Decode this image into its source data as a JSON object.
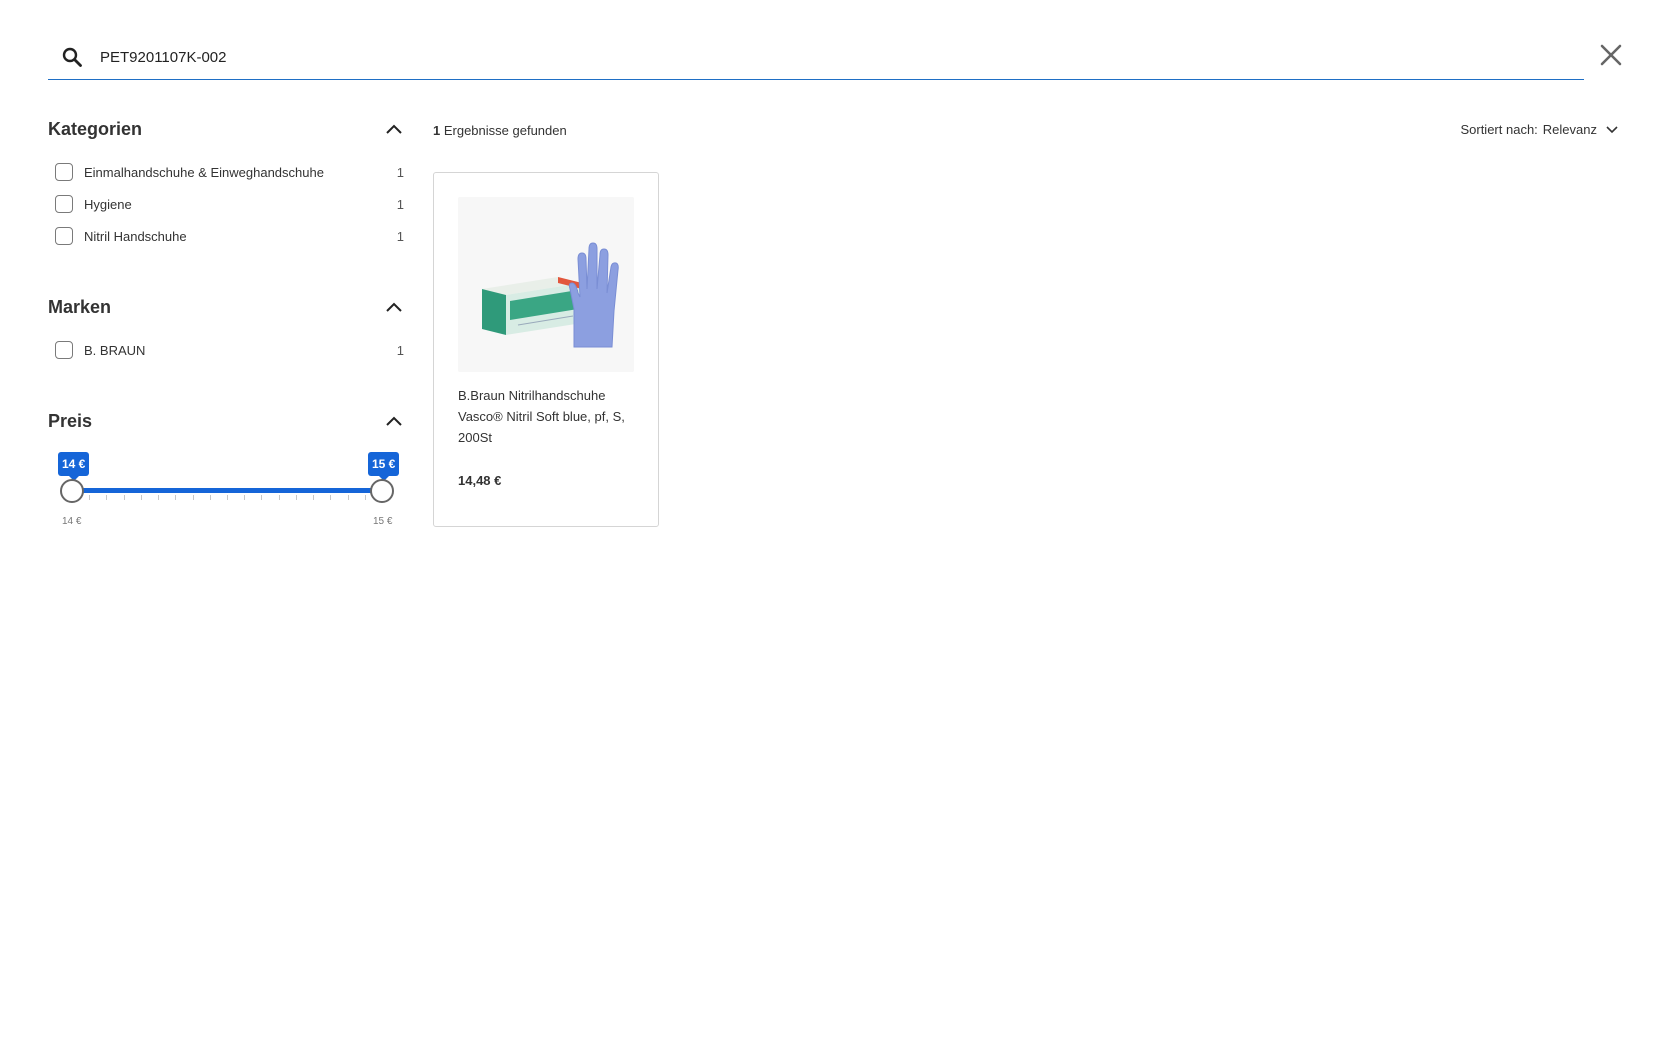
{
  "search": {
    "value": "PET9201107K-002",
    "accent_color": "#1f6fc5"
  },
  "icons": {
    "search": "search-icon",
    "close": "close-icon",
    "collapse": "chevron-up-icon",
    "sort": "chevron-down-icon"
  },
  "facets": {
    "kategorien": {
      "title": "Kategorien",
      "items": [
        {
          "label": "Einmalhandschuhe & Einweghandschuhe",
          "count": "1"
        },
        {
          "label": "Hygiene",
          "count": "1"
        },
        {
          "label": "Nitril Handschuhe",
          "count": "1"
        }
      ]
    },
    "marken": {
      "title": "Marken",
      "items": [
        {
          "label": "B. BRAUN",
          "count": "1"
        }
      ]
    },
    "preis": {
      "title": "Preis",
      "min_bubble": "14 €",
      "max_bubble": "15 €",
      "min_label": "14 €",
      "max_label": "15 €",
      "accent_color": "#1565d8"
    }
  },
  "results": {
    "count": "1",
    "count_text": " Ergebnisse gefunden",
    "sort_label": "Sortiert nach:",
    "sort_value": "Relevanz"
  },
  "products": [
    {
      "name": "B.Braun Nitrilhandschuhe Vasco® Nitril Soft blue, pf, S, 200St",
      "price": "14,48 €"
    }
  ]
}
